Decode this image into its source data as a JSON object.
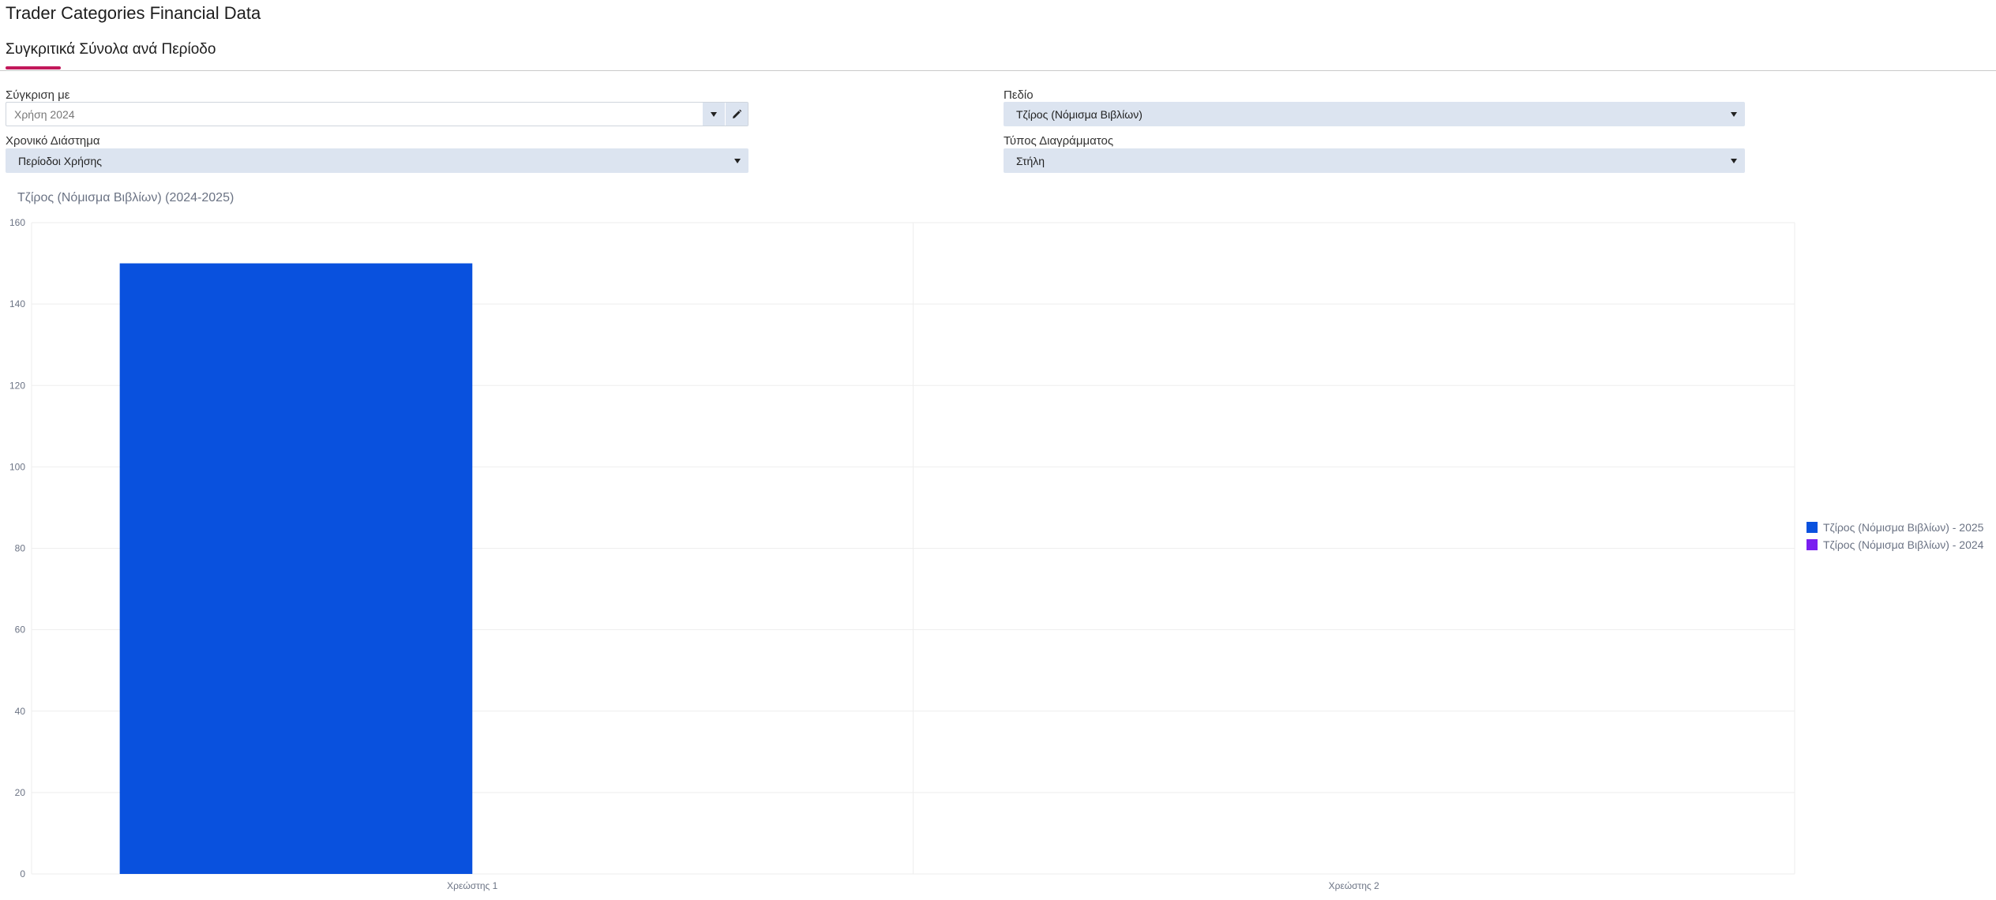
{
  "app": {
    "title": "Trader Categories Financial Data"
  },
  "tabs": [
    {
      "label": "Συγκριτικά Σύνολα ανά Περίοδο",
      "active": true
    }
  ],
  "filters": {
    "compare": {
      "label": "Σύγκριση με",
      "value": "Χρήση 2024",
      "dropdown_icon": "caret-down-icon",
      "edit_icon": "pencil-icon"
    },
    "field": {
      "label": "Πεδίο",
      "value": "Τζίρος (Νόμισμα Βιβλίων)"
    },
    "period": {
      "label": "Χρονικό Διάστημα",
      "value": "Περίοδοι Χρήσης"
    },
    "chart_type": {
      "label": "Τύπος Διαγράμματος",
      "value": "Στήλη"
    }
  },
  "colors": {
    "accent": "#c2185b",
    "series_2025": "#0951de",
    "series_2024": "#7a1ff0"
  },
  "chart_data": {
    "type": "bar",
    "title": "Τζίρος (Νόμισμα Βιβλίων) (2024-2025)",
    "categories": [
      "Χρεώστης 1",
      "Χρεώστης 2"
    ],
    "series": [
      {
        "name": "Τζίρος (Νόμισμα Βιβλίων) - 2025",
        "values": [
          150,
          0
        ]
      },
      {
        "name": "Τζίρος (Νόμισμα Βιβλίων) - 2024",
        "values": [
          0,
          0
        ]
      }
    ],
    "ylim": [
      0,
      160
    ],
    "yticks": [
      0,
      20,
      40,
      60,
      80,
      100,
      120,
      140,
      160
    ],
    "grid": true,
    "legend": "right"
  }
}
